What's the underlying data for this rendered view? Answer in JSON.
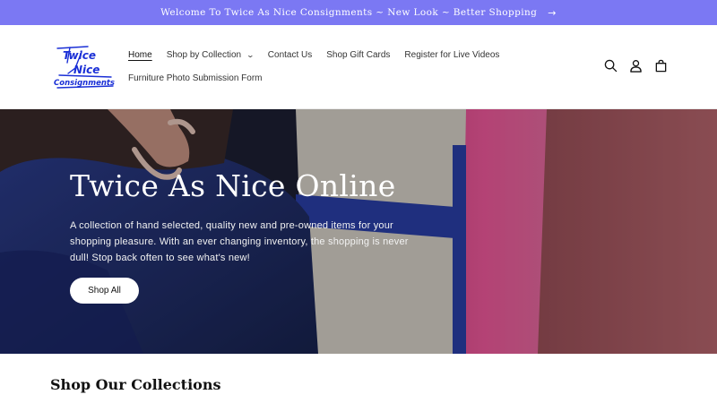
{
  "announcement": {
    "text": "Welcome To Twice As Nice Consignments ~ New Look ~ Better Shopping",
    "arrow": "→",
    "bg_color": "#7b78f3"
  },
  "header": {
    "logo": {
      "line1": "Twice",
      "line2": "Nice",
      "line3": "Consignments",
      "color": "#1a2fd6"
    },
    "nav": [
      {
        "label": "Home",
        "active": true
      },
      {
        "label": "Shop by Collection",
        "has_dropdown": true
      },
      {
        "label": "Contact Us"
      },
      {
        "label": "Shop Gift Cards"
      },
      {
        "label": "Register for Live Videos"
      },
      {
        "label": "Furniture Photo Submission Form"
      }
    ],
    "icons": [
      "search-icon",
      "account-icon",
      "cart-icon"
    ]
  },
  "hero": {
    "title": "Twice As Nice Online",
    "text": "A collection of hand selected, quality new and pre-owned items for your shopping pleasure. With an ever changing inventory, the shopping is never dull! Stop back often to see what's new!",
    "button": "Shop All"
  },
  "collections": {
    "title": "Shop Our Collections"
  }
}
